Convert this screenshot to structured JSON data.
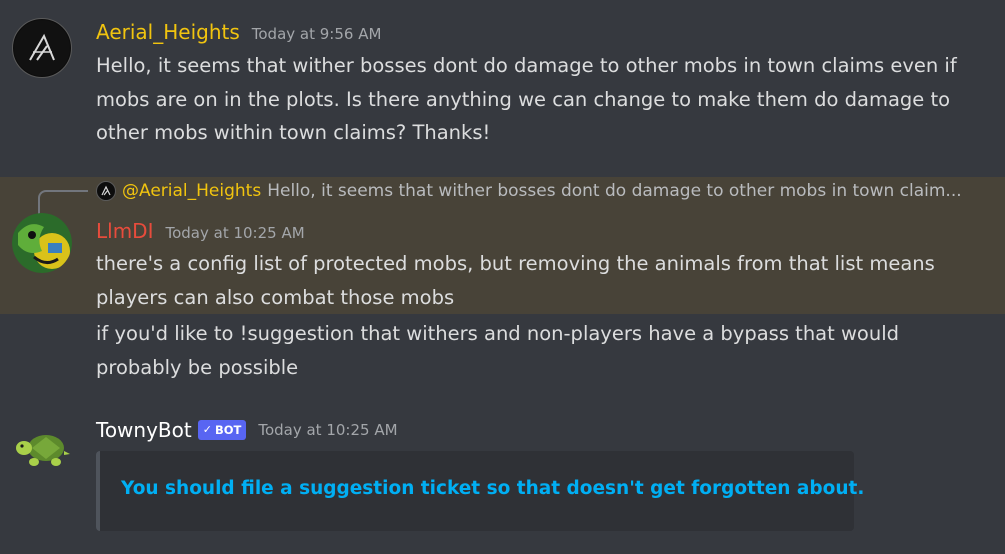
{
  "messages": [
    {
      "author": "Aerial_Heights",
      "author_color": "#f1c40f",
      "timestamp": "Today at 9:56 AM",
      "text": "Hello, it seems that wither bosses dont do damage to other mobs in town claims even if mobs are on in the plots. Is there anything we can change to make them do damage to other mobs within town claims? Thanks!",
      "avatar_icon": "wing-logo-icon"
    },
    {
      "reply": {
        "author": "@Aerial_Heights",
        "text": "Hello, it seems that wither bosses dont do damage to other mobs in town claim..."
      },
      "author": "LlmDI",
      "author_color": "#e74c3c",
      "timestamp": "Today at 10:25 AM",
      "text": "there's a config list of protected mobs, but removing the animals from that list means players can also combat those mobs",
      "highlight_color": "#484338",
      "avatar_icon": "green-creature-avatar"
    },
    {
      "text": "if you'd like to !suggestion that withers and non-players have a bypass that would probably be possible"
    },
    {
      "author": "TownyBot",
      "author_color": "#ffffff",
      "bot_tag": "BOT",
      "bot_check": "✓",
      "bot_tag_color": "#5865f2",
      "timestamp": "Today at 10:25 AM",
      "embed_title": "You should file a suggestion ticket so that doesn't get forgotten about.",
      "embed_title_color": "#00aff4",
      "avatar_icon": "turtle-icon"
    }
  ]
}
